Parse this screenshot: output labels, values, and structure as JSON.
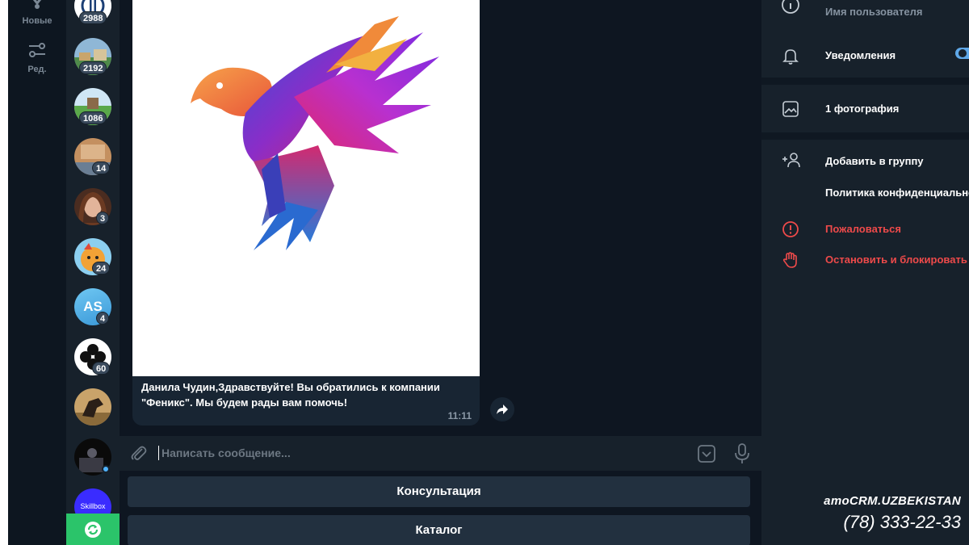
{
  "nav": {
    "new_label": "Новые",
    "edit_label": "Ред."
  },
  "chats": [
    {
      "badge": "2988"
    },
    {
      "badge": "2192"
    },
    {
      "badge": "1086"
    },
    {
      "badge": "14"
    },
    {
      "badge": "3"
    },
    {
      "badge": "24"
    },
    {
      "badge": "4",
      "initials": "AS"
    },
    {
      "badge": "60"
    },
    {
      "badge": ""
    },
    {
      "badge": ""
    },
    {
      "badge": "",
      "avatar_text": "Skillbox"
    }
  ],
  "message": {
    "text": "Данила Чудин,Здравствуйте! Вы обратились к компании \"Феникс\". Мы будем рады вам помочь!",
    "time": "11:11"
  },
  "composer": {
    "placeholder": "Написать сообщение..."
  },
  "keyboard": {
    "buttons": [
      "Консультация",
      "Каталог"
    ]
  },
  "profile": {
    "username_label": "Имя пользователя",
    "notifications_label": "Уведомления",
    "notifications_on": true,
    "photos_label": "1 фотография",
    "add_to_group_label": "Добавить в группу",
    "privacy_label": "Политика конфиденциальности",
    "report_label": "Пожаловаться",
    "block_label": "Остановить и блокировать"
  },
  "watermark": {
    "logo": "amoCRM.UZBEKISTAN",
    "phone": "(78) 333-22-33"
  },
  "colors": {
    "accent": "#5fa8e8",
    "danger": "#ee4a4a",
    "sync_green": "#2bc46a"
  }
}
